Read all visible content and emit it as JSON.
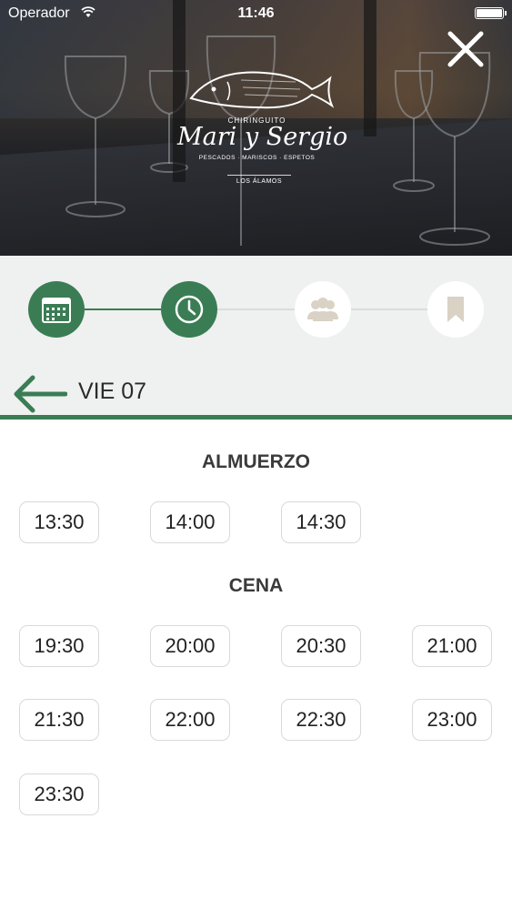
{
  "status_bar": {
    "carrier": "Operador",
    "time": "11:46"
  },
  "logo": {
    "subtitle": "CHIRINGUITO",
    "name": "Mari y Sergio",
    "tagline": "PESCADOS · MARISCOS · ESPETOS",
    "location": "LOS ÁLAMOS"
  },
  "steps": [
    {
      "icon": "calendar-icon",
      "state": "done"
    },
    {
      "icon": "clock-icon",
      "state": "current"
    },
    {
      "icon": "people-icon",
      "state": "pending"
    },
    {
      "icon": "bookmark-icon",
      "state": "pending"
    }
  ],
  "date_header": {
    "label": "VIE 07"
  },
  "sections": {
    "lunch": {
      "title": "ALMUERZO",
      "times": [
        "13:30",
        "14:00",
        "14:30"
      ]
    },
    "dinner": {
      "title": "CENA",
      "times": [
        "19:30",
        "20:00",
        "20:30",
        "21:00",
        "21:30",
        "22:00",
        "22:30",
        "23:00",
        "23:30"
      ]
    }
  },
  "colors": {
    "accent": "#3a7d54",
    "panel": "#eff0f0",
    "step_inactive_icon": "#d9d2c5"
  }
}
